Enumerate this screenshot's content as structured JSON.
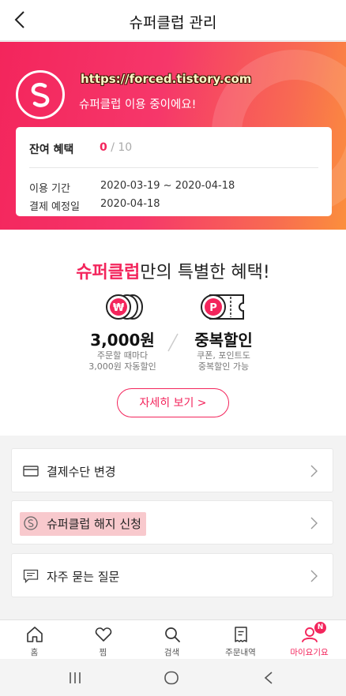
{
  "header": {
    "title": "슈퍼클럽 관리"
  },
  "hero": {
    "watermark": "https://forced.tistory.com",
    "status": "슈퍼클럽 이용 중이에요!",
    "accent_color": "#f3255c"
  },
  "card": {
    "remaining_label": "잔여 혜택",
    "remaining_used": "0",
    "remaining_total": "/ 10",
    "period_label": "이용 기간",
    "period_value": "2020-03-19 ~ 2020-04-18",
    "payment_label": "결제 예정일",
    "payment_value": "2020-04-18"
  },
  "benefit": {
    "headline_brand": "슈퍼클럽",
    "headline_rest": "만의 특별한 혜택!",
    "items": [
      {
        "icon": "won-coins-icon",
        "value": "3,000원",
        "desc1": "주문할 때마다",
        "desc2": "3,000원 자동할인"
      },
      {
        "icon": "point-coupon-icon",
        "value": "중복할인",
        "desc1": "쿠폰, 포인트도",
        "desc2": "중복할인 가능"
      }
    ],
    "detail_button": "자세히 보기 >"
  },
  "menu": [
    {
      "icon": "credit-card-icon",
      "label": "결제수단 변경"
    },
    {
      "icon": "cancel-subscription-icon",
      "label": "슈퍼클럽 해지 신청"
    },
    {
      "icon": "faq-chat-icon",
      "label": "자주 묻는 질문"
    }
  ],
  "tabbar": [
    {
      "icon": "home-icon",
      "label": "홈"
    },
    {
      "icon": "heart-icon",
      "label": "찜"
    },
    {
      "icon": "search-icon",
      "label": "검색"
    },
    {
      "icon": "order-list-icon",
      "label": "주문내역"
    },
    {
      "icon": "my-page-icon",
      "label": "마이요기요",
      "badge": "N",
      "active": true
    }
  ],
  "system_nav": [
    "recents-icon",
    "home-circle-icon",
    "back-icon"
  ]
}
